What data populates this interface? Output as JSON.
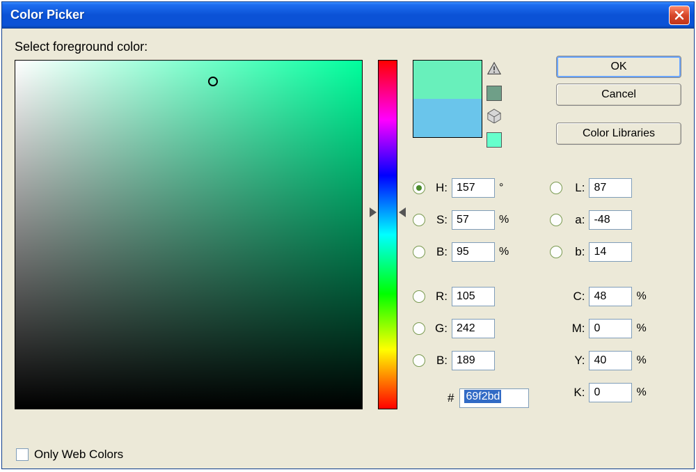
{
  "window": {
    "title": "Color Picker"
  },
  "caption": "Select foreground color:",
  "buttons": {
    "ok": "OK",
    "cancel": "Cancel",
    "colorLibraries": "Color Libraries"
  },
  "swatch": {
    "new_color": "#68f0bb",
    "old_color": "#6ac5eb",
    "gamut_chip": "#6f9f88",
    "websafe_chip": "#66ffcc"
  },
  "hue_base_color": "#00ff9d",
  "cursor": {
    "x_pct": 57,
    "y_pct": 6
  },
  "hue_pos_pct": 43.6,
  "fields": {
    "H": {
      "label": "H:",
      "value": "157",
      "unit": "°",
      "radio": true,
      "selected": true
    },
    "S": {
      "label": "S:",
      "value": "57",
      "unit": "%",
      "radio": true,
      "selected": false
    },
    "Bv": {
      "label": "B:",
      "value": "95",
      "unit": "%",
      "radio": true,
      "selected": false
    },
    "R": {
      "label": "R:",
      "value": "105",
      "unit": "",
      "radio": true,
      "selected": false
    },
    "G": {
      "label": "G:",
      "value": "242",
      "unit": "",
      "radio": true,
      "selected": false
    },
    "Bc": {
      "label": "B:",
      "value": "189",
      "unit": "",
      "radio": true,
      "selected": false
    },
    "L": {
      "label": "L:",
      "value": "87",
      "unit": "",
      "radio": true,
      "selected": false
    },
    "a": {
      "label": "a:",
      "value": "-48",
      "unit": "",
      "radio": true,
      "selected": false
    },
    "b": {
      "label": "b:",
      "value": "14",
      "unit": "",
      "radio": true,
      "selected": false
    },
    "C": {
      "label": "C:",
      "value": "48",
      "unit": "%",
      "radio": false
    },
    "M": {
      "label": "M:",
      "value": "0",
      "unit": "%",
      "radio": false
    },
    "Y": {
      "label": "Y:",
      "value": "40",
      "unit": "%",
      "radio": false
    },
    "K": {
      "label": "K:",
      "value": "0",
      "unit": "%",
      "radio": false
    }
  },
  "hex": {
    "label": "#",
    "value": "69f2bd"
  },
  "checkbox": {
    "label": "Only Web Colors",
    "checked": false
  }
}
